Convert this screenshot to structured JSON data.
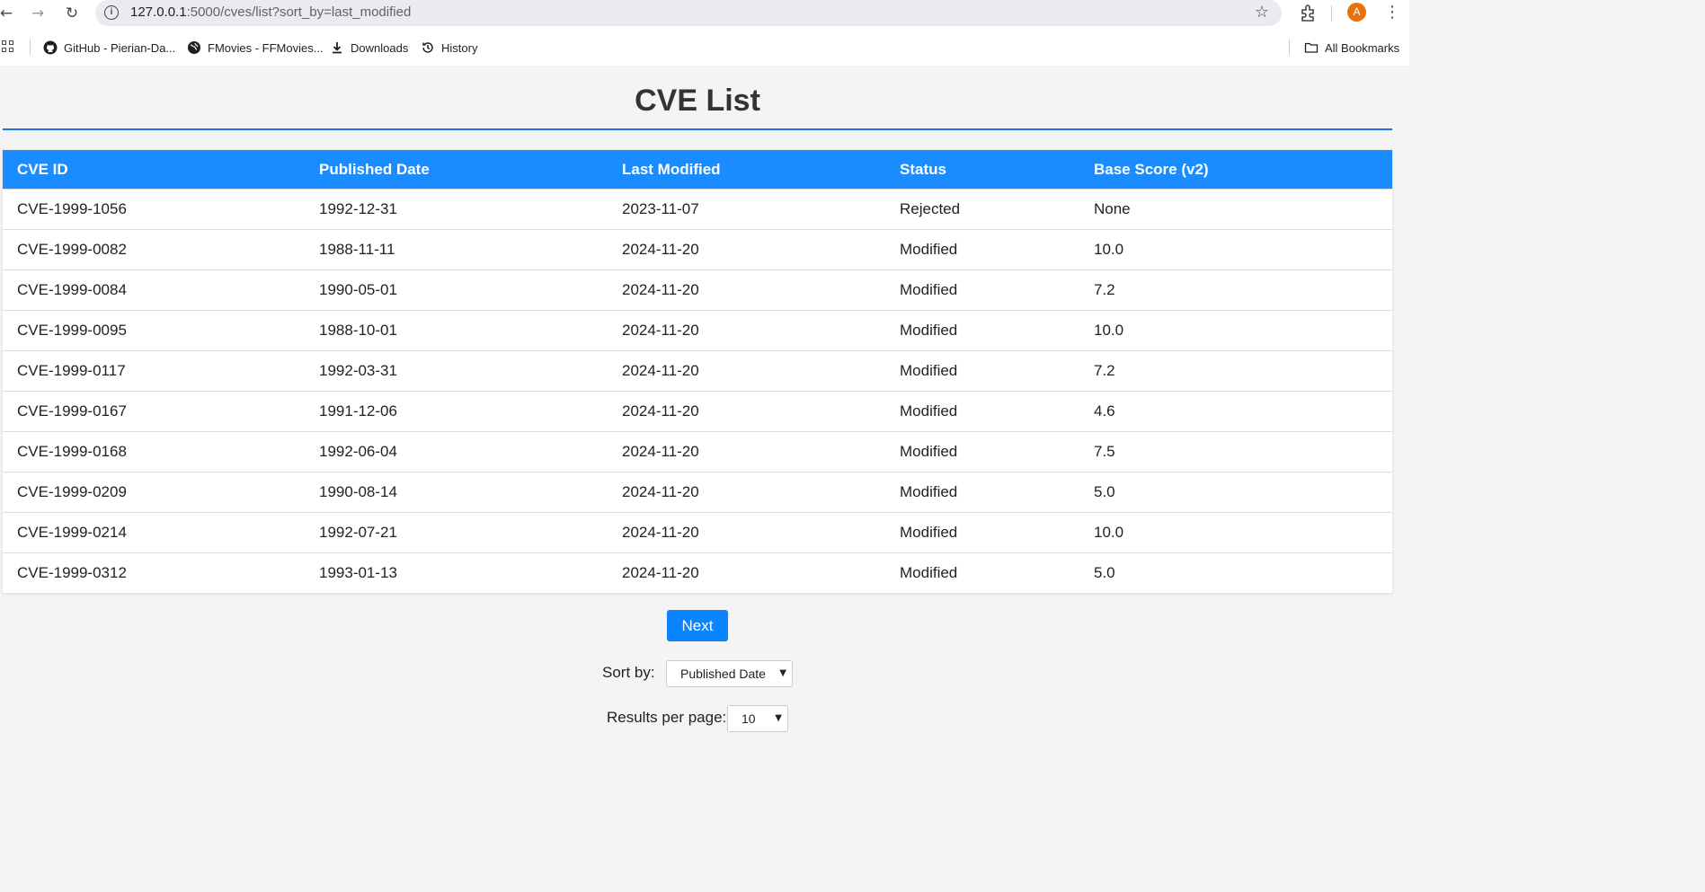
{
  "browser": {
    "url_host": "127.0.0.1",
    "url_rest": ":5000/cves/list?sort_by=last_modified",
    "avatar_letter": "A",
    "bookmarks": [
      {
        "label": "GitHub - Pierian-Da...",
        "icon": "github-icon"
      },
      {
        "label": "FMovies - FFMovies...",
        "icon": "globe-icon"
      },
      {
        "label": "Downloads",
        "icon": "download-icon"
      },
      {
        "label": "History",
        "icon": "history-icon"
      }
    ],
    "all_bookmarks_label": "All Bookmarks"
  },
  "page": {
    "title": "CVE List",
    "accent_color": "#1a8cff"
  },
  "table": {
    "headers": [
      "CVE ID",
      "Published Date",
      "Last Modified",
      "Status",
      "Base Score (v2)"
    ],
    "rows": [
      [
        "CVE-1999-1056",
        "1992-12-31",
        "2023-11-07",
        "Rejected",
        "None"
      ],
      [
        "CVE-1999-0082",
        "1988-11-11",
        "2024-11-20",
        "Modified",
        "10.0"
      ],
      [
        "CVE-1999-0084",
        "1990-05-01",
        "2024-11-20",
        "Modified",
        "7.2"
      ],
      [
        "CVE-1999-0095",
        "1988-10-01",
        "2024-11-20",
        "Modified",
        "10.0"
      ],
      [
        "CVE-1999-0117",
        "1992-03-31",
        "2024-11-20",
        "Modified",
        "7.2"
      ],
      [
        "CVE-1999-0167",
        "1991-12-06",
        "2024-11-20",
        "Modified",
        "4.6"
      ],
      [
        "CVE-1999-0168",
        "1992-06-04",
        "2024-11-20",
        "Modified",
        "7.5"
      ],
      [
        "CVE-1999-0209",
        "1990-08-14",
        "2024-11-20",
        "Modified",
        "5.0"
      ],
      [
        "CVE-1999-0214",
        "1992-07-21",
        "2024-11-20",
        "Modified",
        "10.0"
      ],
      [
        "CVE-1999-0312",
        "1993-01-13",
        "2024-11-20",
        "Modified",
        "5.0"
      ]
    ]
  },
  "controls": {
    "next_label": "Next",
    "sort_label": "Sort by:",
    "sort_value": "Published Date",
    "per_page_label": "Results per page:",
    "per_page_value": "10"
  }
}
